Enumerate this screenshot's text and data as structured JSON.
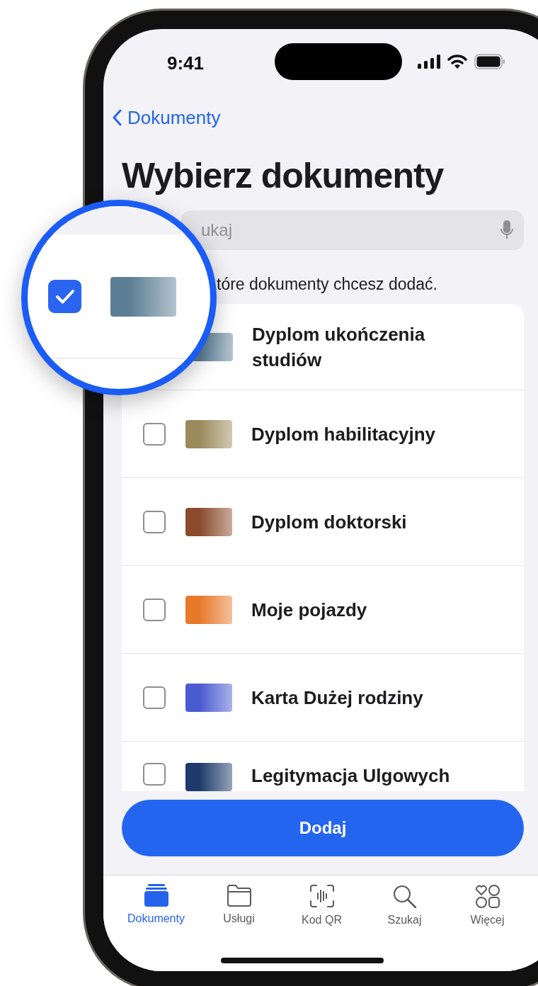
{
  "status_bar": {
    "time": "9:41"
  },
  "nav": {
    "back": "Dokumenty"
  },
  "title": "Wybierz dokumenty",
  "search": {
    "placeholder": "ukaj"
  },
  "subtitle": "tóre dokumenty chcesz dodać.",
  "documents": [
    {
      "name": "Dyplom ukończenia studiów",
      "checked": true,
      "color": "#5d7f96"
    },
    {
      "name": "Dyplom habilitacyjny",
      "checked": false,
      "color": "#9a8a5c"
    },
    {
      "name": "Dyplom doktorski",
      "checked": false,
      "color": "#8a4a2c"
    },
    {
      "name": "Moje pojazdy",
      "checked": false,
      "color": "#e8782a"
    },
    {
      "name": "Karta Dużej rodziny",
      "checked": false,
      "color": "#4a5ad0"
    },
    {
      "name": "Legitymacja Ulgowych",
      "checked": false,
      "color": "#1e3a6a"
    }
  ],
  "add_button": "Dodaj",
  "tabs": [
    {
      "label": "Dokumenty",
      "kind": "documents",
      "selected": true
    },
    {
      "label": "Usługi",
      "kind": "folder",
      "selected": false
    },
    {
      "label": "Kod QR",
      "kind": "scan",
      "selected": false
    },
    {
      "label": "Szukaj",
      "kind": "search",
      "selected": false
    },
    {
      "label": "Więcej",
      "kind": "more",
      "selected": false
    }
  ]
}
